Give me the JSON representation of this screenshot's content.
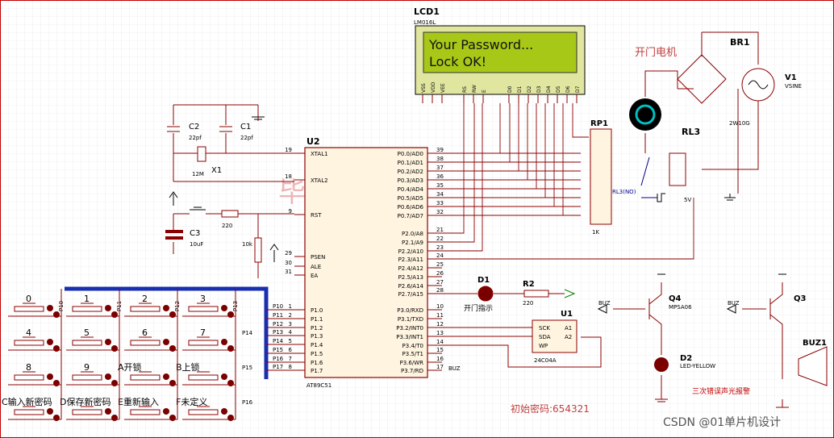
{
  "lcd": {
    "ref": "LCD1",
    "part": "LM016L",
    "line1": "Your Password...",
    "line2": "Lock OK!",
    "pins": [
      "VSS",
      "VDD",
      "VEE",
      "RS",
      "RW",
      "E",
      "D0",
      "D1",
      "D2",
      "D3",
      "D4",
      "D5",
      "D6",
      "D7"
    ]
  },
  "mcu": {
    "ref": "U2",
    "part": "AT89C51",
    "left_pins": [
      "XTAL1",
      "XTAL2",
      "RST",
      "PSEN",
      "ALE",
      "EA",
      "P1.0",
      "P1.1",
      "P1.2",
      "P1.3",
      "P1.4",
      "P1.5",
      "P1.6",
      "P1.7"
    ],
    "left_nums": [
      "19",
      "18",
      "9",
      "29",
      "30",
      "31",
      "1",
      "2",
      "3",
      "4",
      "5",
      "6",
      "7",
      "8"
    ],
    "right_pins": [
      "P0.0/AD0",
      "P0.1/AD1",
      "P0.2/AD2",
      "P0.3/AD3",
      "P0.4/AD4",
      "P0.5/AD5",
      "P0.6/AD6",
      "P0.7/AD7",
      "P2.0/A8",
      "P2.1/A9",
      "P2.2/A10",
      "P2.3/A11",
      "P2.4/A12",
      "P2.5/A13",
      "P2.6/A14",
      "P2.7/A15",
      "P3.0/RXD",
      "P3.1/TXD",
      "P3.2/INT0",
      "P3.3/INT1",
      "P3.4/T0",
      "P3.5/T1",
      "P3.6/WR",
      "P3.7/RD"
    ],
    "right_nums": [
      "39",
      "38",
      "37",
      "36",
      "35",
      "34",
      "33",
      "32",
      "21",
      "22",
      "23",
      "24",
      "25",
      "26",
      "27",
      "28",
      "10",
      "11",
      "12",
      "13",
      "14",
      "15",
      "16",
      "17"
    ]
  },
  "labels": {
    "c2": "C2",
    "c2v": "22pf",
    "c1": "C1",
    "c1v": "22pf",
    "x1": "X1",
    "x1v": "12M",
    "c3": "C3",
    "c3v": "10uF",
    "r_rst": "220",
    "r10k": "10k",
    "rp1": "RP1",
    "rp1v": "1K",
    "d1": "D1",
    "d1_note": "开门指示",
    "r2": "R2",
    "r2v": "220",
    "u1": "U1",
    "u1v": "24C04A",
    "u1_pins": [
      "SCK",
      "SDA",
      "WP",
      "A1",
      "A2"
    ],
    "q4": "Q4",
    "q4v": "MPSA06",
    "q3": "Q3",
    "d2": "D2",
    "d2v": "LED-YELLOW",
    "buz1": "BUZ1",
    "buz": "BUZ",
    "br1": "BR1",
    "br1v": "2W10G",
    "v1": "V1",
    "v1v": "VSINE",
    "rl3": "RL3",
    "rl3n": "RL3(NO)",
    "rl3v": "5V",
    "motor": "开门电机",
    "alarm": "三次错误声光报警",
    "init_pwd": "初始密码:654321",
    "watermark": "毕设课",
    "credit": "CSDN @01单片机设计"
  },
  "keypad": {
    "keys": [
      {
        "label": "0"
      },
      {
        "label": "1"
      },
      {
        "label": "2"
      },
      {
        "label": "3"
      },
      {
        "label": "4"
      },
      {
        "label": "5"
      },
      {
        "label": "6"
      },
      {
        "label": "7"
      },
      {
        "label": "8"
      },
      {
        "label": "9"
      },
      {
        "label": "A开锁"
      },
      {
        "label": "B上锁"
      },
      {
        "label": "C输入新密码"
      },
      {
        "label": "D保存新密码"
      },
      {
        "label": "E重新输入"
      },
      {
        "label": "F未定义"
      }
    ],
    "col_nets": [
      "P10",
      "P11",
      "P12",
      "P13"
    ],
    "row_nets": [
      "P14",
      "P15",
      "P16"
    ],
    "bus_nets": [
      "P10",
      "P11",
      "P12",
      "P13",
      "P14",
      "P15",
      "P16",
      "P17"
    ]
  }
}
